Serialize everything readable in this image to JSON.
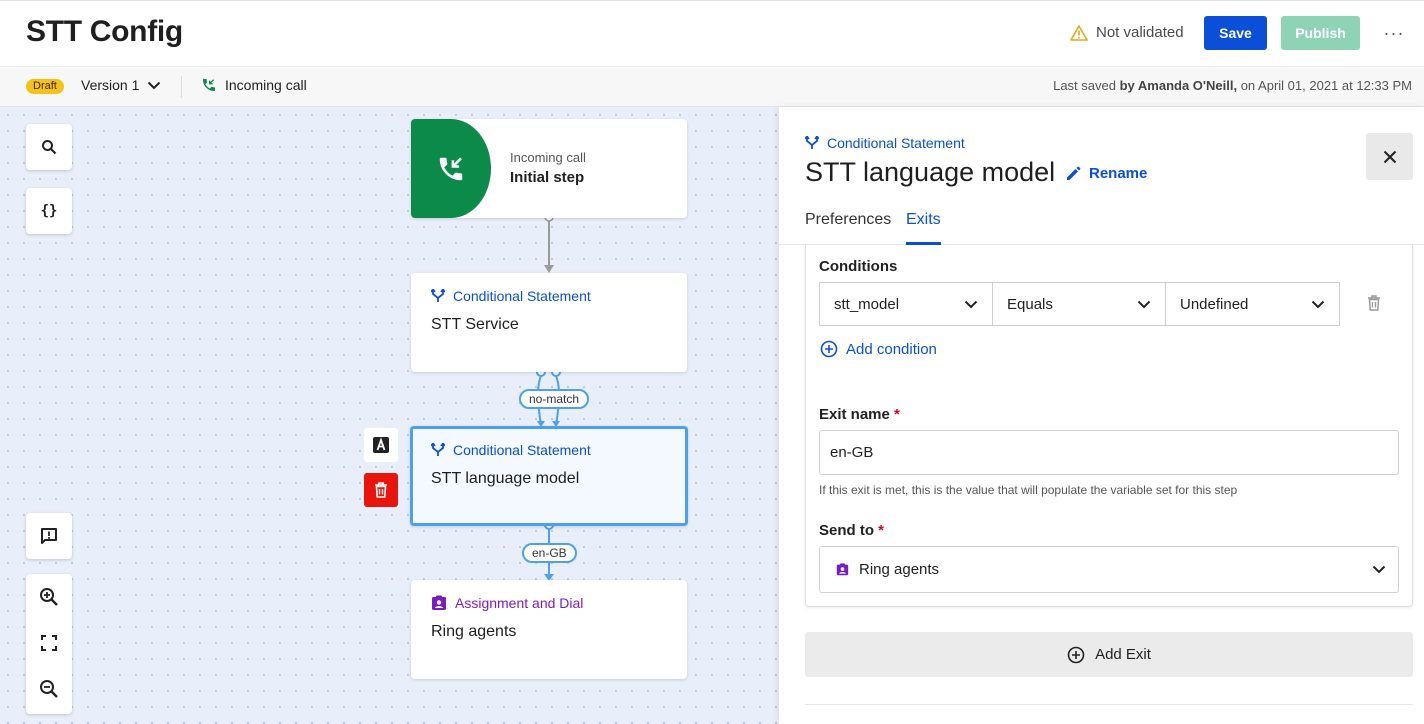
{
  "header": {
    "title": "STT Config",
    "validation": "Not validated",
    "save_label": "Save",
    "publish_label": "Publish",
    "more_label": "···"
  },
  "subbar": {
    "badge": "Draft",
    "version": "Version 1",
    "trigger": "Incoming call",
    "last_saved_prefix": "Last saved",
    "last_saved_by": "by Amanda O'Neill,",
    "last_saved_date": "on April 01, 2021 at 12:33 PM"
  },
  "canvas": {
    "tools": {
      "search_icon": "search-icon",
      "variables_label": "{}"
    },
    "nodes": [
      {
        "kind": "Incoming call",
        "title": "Initial step"
      },
      {
        "kind": "Conditional Statement",
        "title": "STT Service"
      },
      {
        "kind": "Conditional Statement",
        "title": "STT language model"
      },
      {
        "kind": "Assignment and Dial",
        "title": "Ring agents"
      }
    ],
    "edges": [
      {
        "label": "no-match"
      },
      {
        "label": "en-GB"
      }
    ]
  },
  "panel": {
    "kind": "Conditional Statement",
    "title": "STT language model",
    "rename_label": "Rename",
    "tabs": [
      "Preferences",
      "Exits"
    ],
    "active_tab": "Exits",
    "conditions_label": "Conditions",
    "condition": {
      "variable": "stt_model",
      "operator": "Equals",
      "value": "Undefined"
    },
    "add_condition_label": "Add condition",
    "exit_name_label": "Exit name",
    "exit_name_value": "en-GB",
    "exit_hint": "If this exit is met, this is the value that will populate the variable set for this step",
    "send_to_label": "Send to",
    "send_to_value": "Ring agents",
    "add_exit_label": "Add Exit",
    "required_mark": "*"
  },
  "colors": {
    "primary": "#0a4fd6",
    "publish_disabled": "#8fd3b7",
    "call_green": "#0b8a4a",
    "draft_badge": "#f6c21a",
    "assignment_purple": "#7a1cc4",
    "delete_red": "#e8150c",
    "selection_blue": "#4da0f0"
  }
}
